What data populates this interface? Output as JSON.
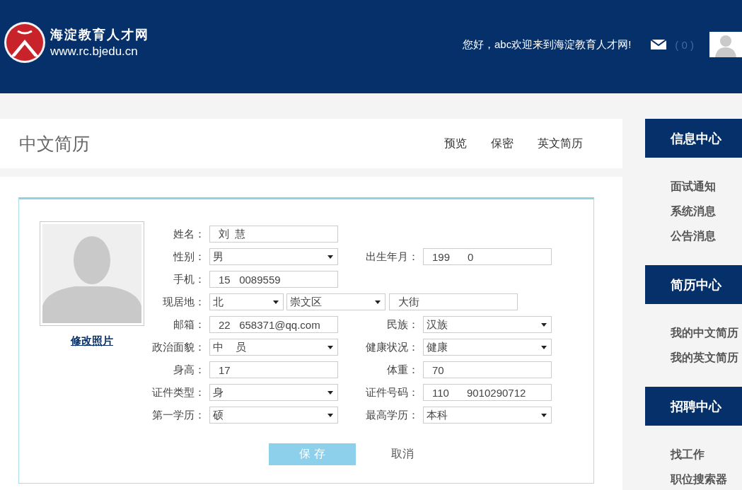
{
  "header": {
    "site_name": "海淀教育人才网",
    "site_url": "www.rc.bjedu.cn",
    "greeting": "您好，abc欢迎来到海淀教育人才网!",
    "message_count": "( 0 )"
  },
  "page": {
    "title": "中文简历",
    "actions": [
      "预览",
      "保密",
      "英文简历"
    ]
  },
  "photo": {
    "link": "修改照片"
  },
  "form": {
    "rows": [
      {
        "left": {
          "label": "姓名：",
          "parts": [
            {
              "kind": "input",
              "value": "刘  慧"
            }
          ]
        }
      },
      {
        "left": {
          "label": "性别：",
          "parts": [
            {
              "kind": "select",
              "value": "男"
            }
          ]
        },
        "right": {
          "label": "出生年月：",
          "parts": [
            {
              "kind": "input",
              "value": "199      0"
            }
          ]
        }
      },
      {
        "left": {
          "label": "手机：",
          "parts": [
            {
              "kind": "input",
              "value": "15   0089559"
            }
          ]
        }
      },
      {
        "left": {
          "label": "现居地：",
          "parts": [
            {
              "kind": "select",
              "value": "北"
            },
            {
              "kind": "select",
              "value": "崇文区"
            },
            {
              "kind": "input",
              "value": "大街"
            }
          ]
        }
      },
      {
        "left": {
          "label": "邮箱：",
          "parts": [
            {
              "kind": "input",
              "value": "22   658371@qq.com"
            }
          ]
        },
        "right": {
          "label": "民族：",
          "parts": [
            {
              "kind": "select",
              "value": "汉族"
            }
          ]
        }
      },
      {
        "left": {
          "label": "政治面貌：",
          "parts": [
            {
              "kind": "select",
              "value": "中    员"
            }
          ]
        },
        "right": {
          "label": "健康状况：",
          "parts": [
            {
              "kind": "select",
              "value": "健康"
            }
          ]
        }
      },
      {
        "left": {
          "label": "身高：",
          "parts": [
            {
              "kind": "input",
              "value": "17"
            }
          ]
        },
        "right": {
          "label": "体重：",
          "parts": [
            {
              "kind": "input",
              "value": "70"
            }
          ]
        }
      },
      {
        "left": {
          "label": "证件类型：",
          "parts": [
            {
              "kind": "select",
              "value": "身"
            }
          ]
        },
        "right": {
          "label": "证件号码：",
          "parts": [
            {
              "kind": "input",
              "value": "110      9010290712"
            }
          ]
        }
      },
      {
        "left": {
          "label": "第一学历：",
          "parts": [
            {
              "kind": "select",
              "value": "硕"
            }
          ]
        },
        "right": {
          "label": "最高学历：",
          "parts": [
            {
              "kind": "select",
              "value": "本科"
            }
          ]
        }
      }
    ],
    "buttons": [
      "保 存",
      "取消"
    ]
  },
  "sidebar": [
    {
      "title": "信息中心",
      "items": [
        "面试通知",
        "系统消息",
        "公告消息"
      ]
    },
    {
      "title": "简历中心",
      "items": [
        "我的中文简历",
        "我的英文简历"
      ]
    },
    {
      "title": "招聘中心",
      "items": [
        "找工作",
        "职位搜索器"
      ]
    }
  ]
}
